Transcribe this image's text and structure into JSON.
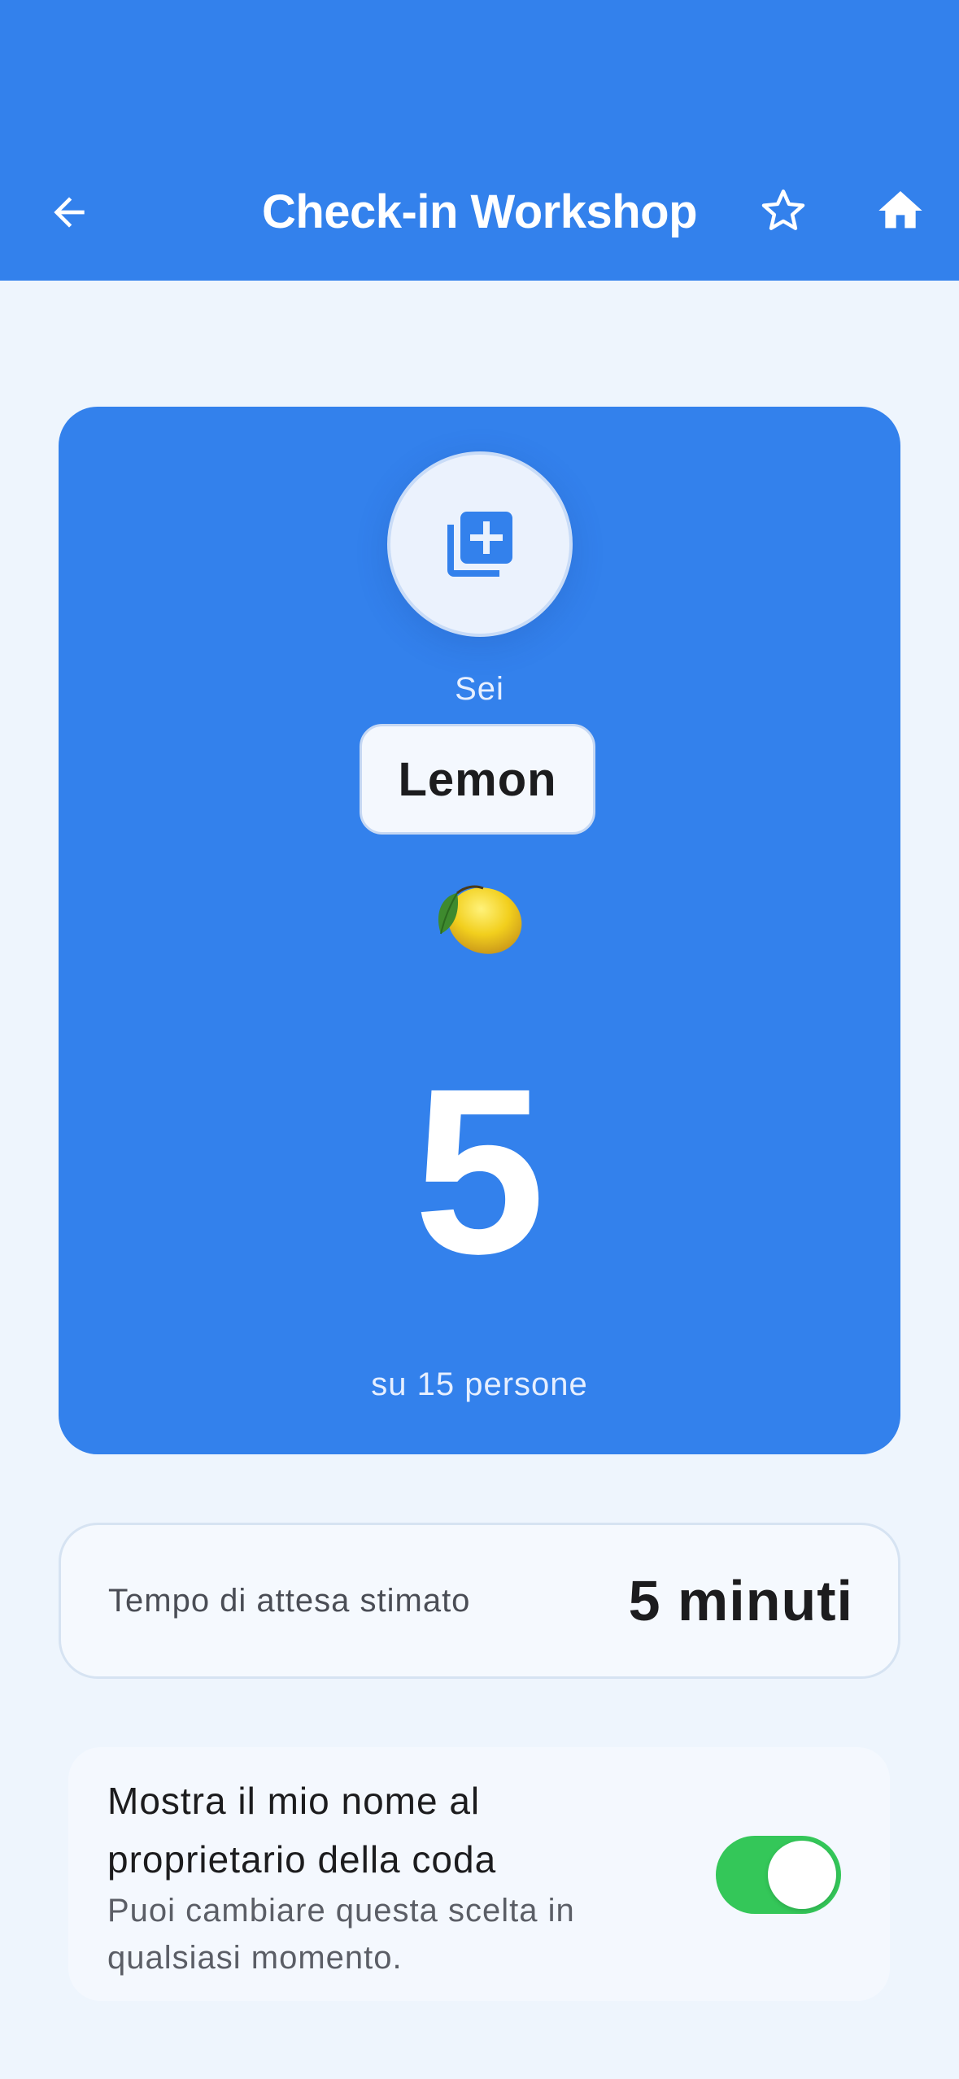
{
  "header": {
    "title": "Check-in Workshop",
    "back_icon": "arrow-left-icon",
    "favorite_icon": "star-outline-icon",
    "home_icon": "home-icon",
    "background": "#3381ec"
  },
  "ticket": {
    "icon": "add-to-queue-icon",
    "you_are_label": "Sei",
    "name": "Lemon",
    "emoji": "lemon-icon",
    "position": "5",
    "total_label": "su 15 persone",
    "background": "#3381ec"
  },
  "wait_time": {
    "label": "Tempo di attesa stimato",
    "value": "5 minuti"
  },
  "privacy": {
    "title": "Mostra il mio nome al proprietario della coda",
    "subtitle": "Puoi cambiare questa scelta in qualsiasi momento.",
    "toggle_on": true,
    "toggle_color": "#34c759"
  }
}
